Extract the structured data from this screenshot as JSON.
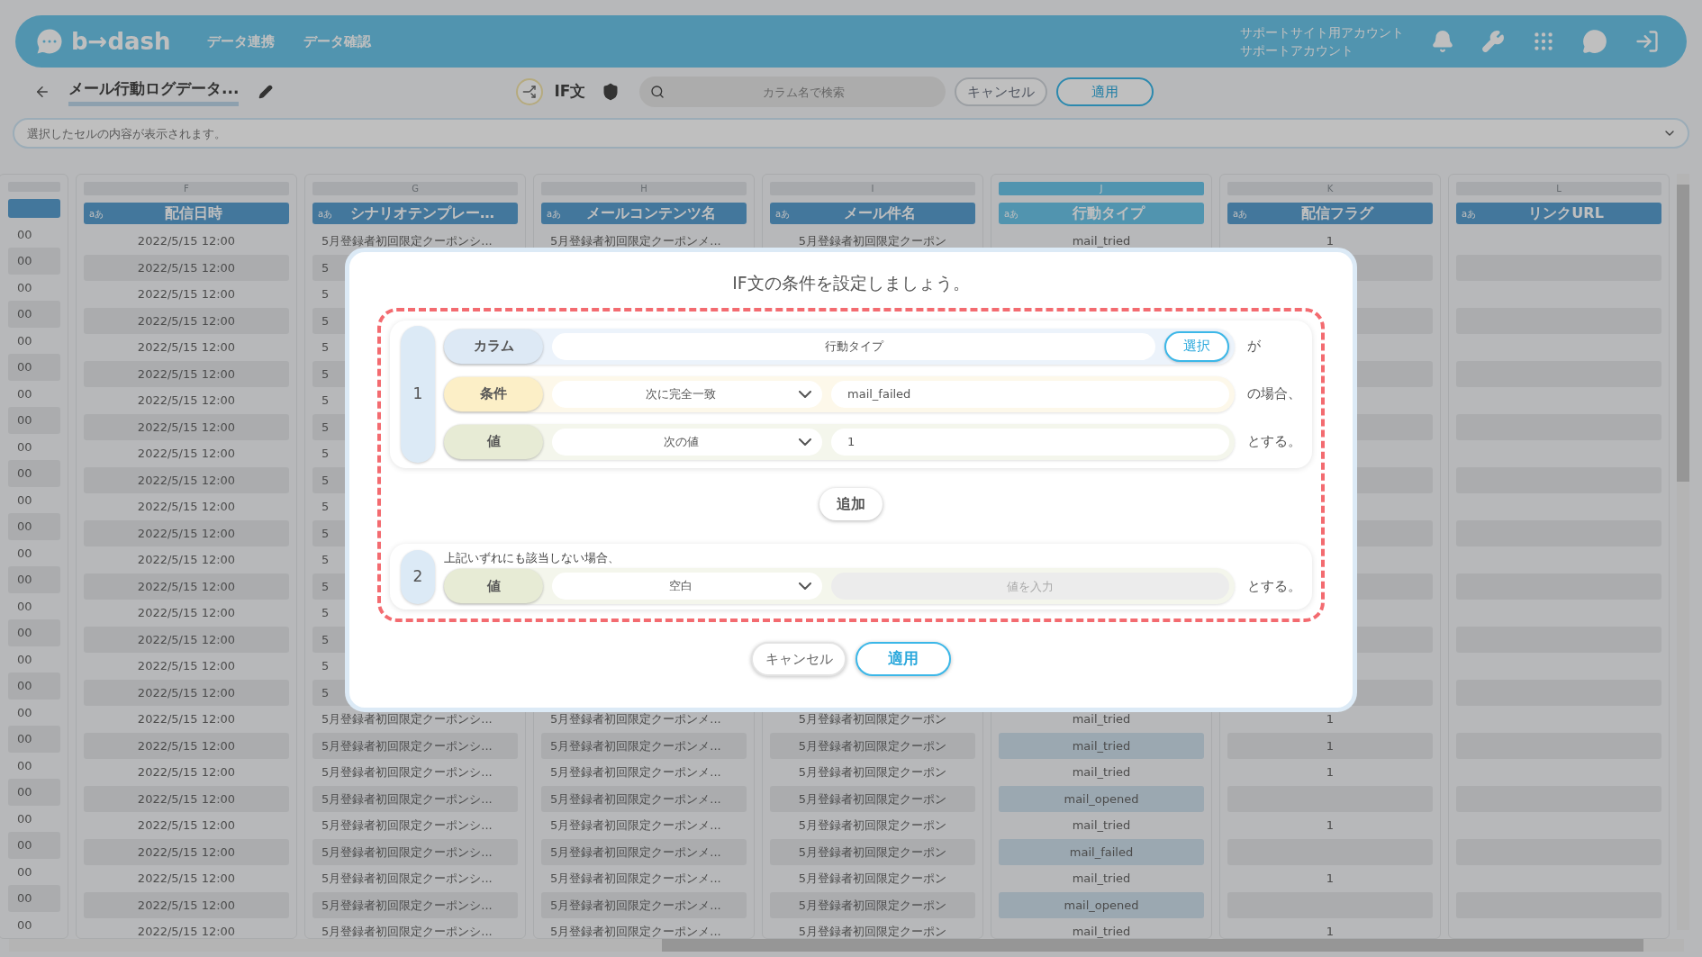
{
  "nav": {
    "logo": "b→dash",
    "menu": [
      "データ連携",
      "データ確認"
    ],
    "account": [
      "サポートサイト用アカウント",
      "サポートアカウント"
    ]
  },
  "toolbar": {
    "title": "メール行動ログデータ...",
    "if_label": "IF文",
    "search": {
      "placeholder": "カラム名で検索"
    },
    "buttons": [
      {
        "label": "キャンセル",
        "kind": "secondary"
      },
      {
        "label": "適用",
        "kind": "primary"
      }
    ]
  },
  "cell_preview": {
    "placeholder": "選択したセルの内容が表示されます。"
  },
  "table": {
    "columns": [
      {
        "selected": false
      },
      {
        "letter": "F",
        "type": "aあ",
        "name": "配信日時",
        "selected": false
      },
      {
        "letter": "G",
        "type": "aあ",
        "name": "シナリオテンプレー…",
        "selected": false
      },
      {
        "letter": "H",
        "type": "aあ",
        "name": "メールコンテンツ名",
        "selected": false
      },
      {
        "letter": "I",
        "type": "aあ",
        "name": "メール件名",
        "selected": false
      },
      {
        "letter": "J",
        "type": "aあ",
        "name": "行動タイプ",
        "selected": true
      },
      {
        "letter": "K",
        "type": "aあ",
        "name": "配信フラグ",
        "selected": false
      },
      {
        "letter": "L",
        "type": "aあ",
        "name": "リンクURL",
        "selected": false
      }
    ],
    "rows": [
      {
        "cells": [
          "00",
          "2022/5/15 12:00",
          "5月登録者初回限定クーポンシ...",
          "5月登録者初回限定クーポンメ...",
          "5月登録者初回限定クーポン",
          "mail_tried",
          "1",
          null
        ]
      },
      {
        "cells": [
          "00",
          "2022/5/15 12:00",
          "5"
        ]
      },
      {
        "cells": [
          "00",
          "2022/5/15 12:00",
          "5"
        ]
      },
      {
        "cells": [
          "00",
          "2022/5/15 12:00",
          "5"
        ]
      },
      {
        "cells": [
          "00",
          "2022/5/15 12:00",
          "5"
        ]
      },
      {
        "cells": [
          "00",
          "2022/5/15 12:00",
          "5"
        ]
      },
      {
        "cells": [
          "00",
          "2022/5/15 12:00",
          "5"
        ]
      },
      {
        "cells": [
          "00",
          "2022/5/15 12:00",
          "5"
        ]
      },
      {
        "cells": [
          "00",
          "2022/5/15 12:00",
          "5"
        ]
      },
      {
        "cells": [
          "00",
          "2022/5/15 12:00",
          "5"
        ]
      },
      {
        "cells": [
          "00",
          "2022/5/15 12:00",
          "5"
        ]
      },
      {
        "cells": [
          "00",
          "2022/5/15 12:00",
          "5"
        ]
      },
      {
        "cells": [
          "00",
          "2022/5/15 12:00",
          "5"
        ]
      },
      {
        "cells": [
          "00",
          "2022/5/15 12:00",
          "5"
        ]
      },
      {
        "cells": [
          "00",
          "2022/5/15 12:00",
          "5"
        ]
      },
      {
        "cells": [
          "00",
          "2022/5/15 12:00",
          "5"
        ]
      },
      {
        "cells": [
          "00",
          "2022/5/15 12:00",
          "5"
        ]
      },
      {
        "cells": [
          "00",
          "2022/5/15 12:00",
          "5"
        ]
      },
      {
        "cells": [
          "00",
          "2022/5/15 12:00",
          "5月登録者初回限定クーポンシ...",
          "5月登録者初回限定クーポンメ...",
          "5月登録者初回限定クーポン",
          "mail_tried",
          "1",
          null
        ]
      },
      {
        "cells": [
          "00",
          "2022/5/15 12:00",
          "5月登録者初回限定クーポンシ...",
          "5月登録者初回限定クーポンメ...",
          "5月登録者初回限定クーポン",
          "mail_tried",
          "1",
          null
        ]
      },
      {
        "cells": [
          "00",
          "2022/5/15 12:00",
          "5月登録者初回限定クーポンシ...",
          "5月登録者初回限定クーポンメ...",
          "5月登録者初回限定クーポン",
          "mail_tried",
          "1",
          null
        ]
      },
      {
        "cells": [
          "00",
          "2022/5/15 12:00",
          "5月登録者初回限定クーポンシ...",
          "5月登録者初回限定クーポンメ...",
          "5月登録者初回限定クーポン",
          "mail_opened",
          null,
          null
        ]
      },
      {
        "cells": [
          "00",
          "2022/5/15 12:00",
          "5月登録者初回限定クーポンシ...",
          "5月登録者初回限定クーポンメ...",
          "5月登録者初回限定クーポン",
          "mail_tried",
          "1",
          null
        ]
      },
      {
        "cells": [
          "00",
          "2022/5/15 12:00",
          "5月登録者初回限定クーポンシ...",
          "5月登録者初回限定クーポンメ...",
          "5月登録者初回限定クーポン",
          "mail_failed",
          null,
          null
        ]
      },
      {
        "cells": [
          "00",
          "2022/5/15 12:00",
          "5月登録者初回限定クーポンシ...",
          "5月登録者初回限定クーポンメ...",
          "5月登録者初回限定クーポン",
          "mail_tried",
          "1",
          null
        ]
      },
      {
        "cells": [
          "00",
          "2022/5/15 12:00",
          "5月登録者初回限定クーポンシ...",
          "5月登録者初回限定クーポンメ...",
          "5月登録者初回限定クーポン",
          "mail_opened",
          null,
          null
        ]
      },
      {
        "cells": [
          "00",
          "2022/5/15 12:00",
          "5月登録者初回限定クーポンシ...",
          "5月登録者初回限定クーポンメ...",
          "5月登録者初回限定クーポン",
          "mail_tried",
          "1",
          null
        ]
      }
    ]
  },
  "dialog": {
    "title": "IF文の条件を設定しましょう。",
    "conditions": [
      {
        "number": "1",
        "rows": [
          {
            "kind": "column",
            "label": "カラム",
            "value": "行動タイプ",
            "button": "選択",
            "suffix": "が"
          },
          {
            "kind": "condition",
            "label": "条件",
            "select": "次に完全一致",
            "input": "mail_failed",
            "suffix": "の場合、"
          },
          {
            "kind": "value",
            "label": "値",
            "select": "次の値",
            "input": "1",
            "suffix": "とする。"
          }
        ]
      }
    ],
    "add_button": "追加",
    "else": {
      "number": "2",
      "caption": "上記いずれにも該当しない場合、",
      "row": {
        "kind": "value",
        "label": "値",
        "select": "空白",
        "placeholder": "値を入力",
        "disabled": true,
        "suffix": "とする。"
      }
    },
    "buttons": [
      {
        "label": "キャンセル",
        "kind": "secondary"
      },
      {
        "label": "適用",
        "kind": "primary"
      }
    ]
  }
}
